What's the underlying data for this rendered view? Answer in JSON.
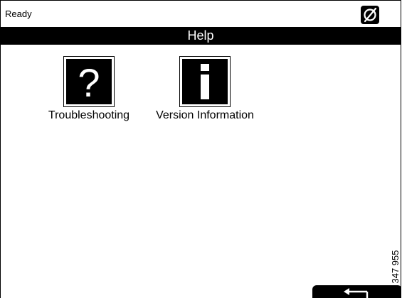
{
  "status": {
    "text": "Ready",
    "icon": "circle-slash-icon"
  },
  "header": {
    "title": "Help"
  },
  "tiles": [
    {
      "label": "Troubleshooting",
      "icon": "question-mark-icon",
      "glyph": "?"
    },
    {
      "label": "Version Information",
      "icon": "info-icon",
      "glyph": "i"
    }
  ],
  "footer": {
    "back_icon": "back-arrow-icon",
    "reference_number": "347 955"
  },
  "colors": {
    "background": "#ffffff",
    "foreground": "#000000"
  }
}
